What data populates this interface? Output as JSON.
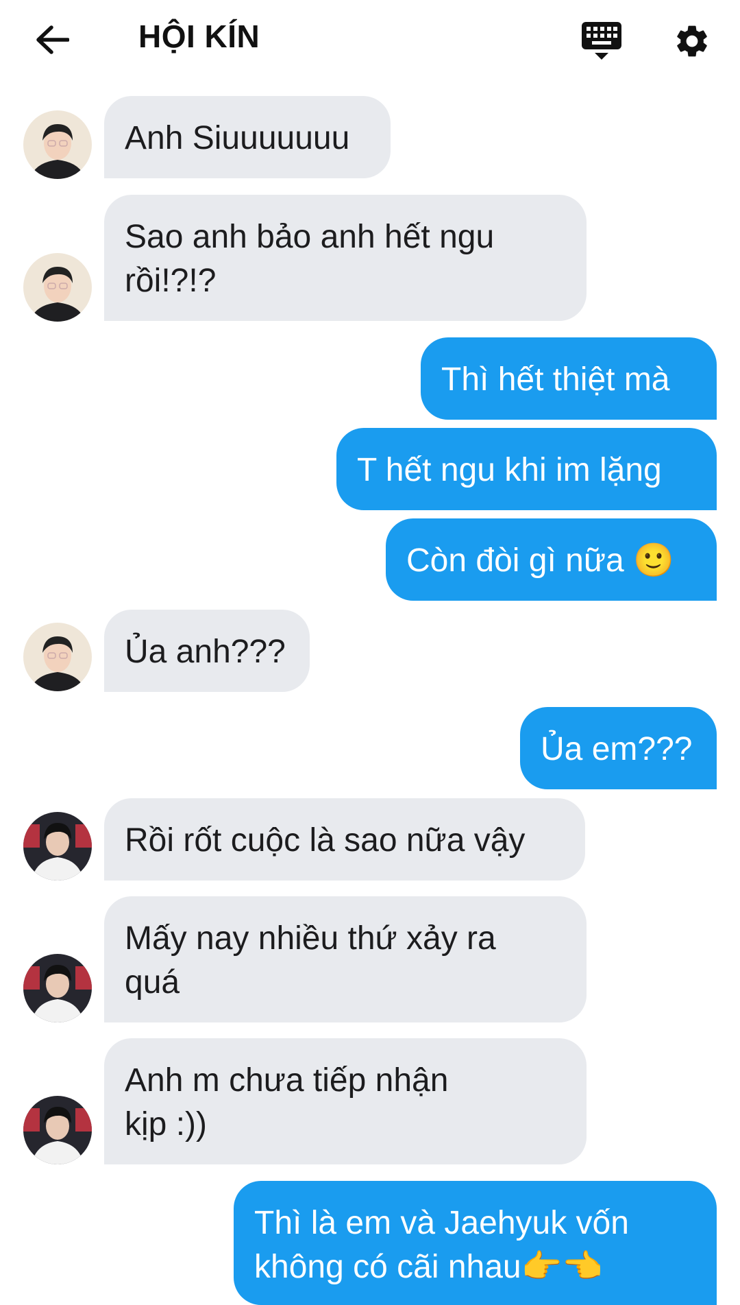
{
  "header": {
    "title": "HỘI KÍN",
    "back_icon": "arrow-left-icon",
    "keyboard_icon": "keyboard-icon",
    "settings_icon": "gear-icon"
  },
  "colors": {
    "incoming_bubble": "#e8eaee",
    "outgoing_bubble": "#1a9cef",
    "incoming_text": "#1c1c1e",
    "outgoing_text": "#ffffff"
  },
  "messages": [
    {
      "side": "in",
      "avatar": "avatar-a",
      "text": "Anh Siuuuuuuu"
    },
    {
      "side": "in",
      "avatar": "avatar-a",
      "text": "Sao anh bảo anh hết ngu\nrồi!?!?"
    },
    {
      "side": "out",
      "text": "Thì hết thiệt mà"
    },
    {
      "side": "out",
      "text": "T hết ngu khi im lặng"
    },
    {
      "side": "out",
      "text": "Còn đòi gì nữa 🙂"
    },
    {
      "side": "in",
      "avatar": "avatar-a",
      "text": "Ủa anh???"
    },
    {
      "side": "out",
      "text": "Ủa em???"
    },
    {
      "side": "in",
      "avatar": "avatar-b",
      "text": "Rồi rốt cuộc là sao nữa vậy"
    },
    {
      "side": "in",
      "avatar": "avatar-b",
      "text": "Mấy nay nhiều thứ xảy ra\nquá"
    },
    {
      "side": "in",
      "avatar": "avatar-b",
      "text": "Anh m chưa tiếp nhận\nkịp :))"
    },
    {
      "side": "out",
      "text": "Thì là em và Jaehyuk vốn\nkhông có cãi nhau👉👈"
    }
  ]
}
